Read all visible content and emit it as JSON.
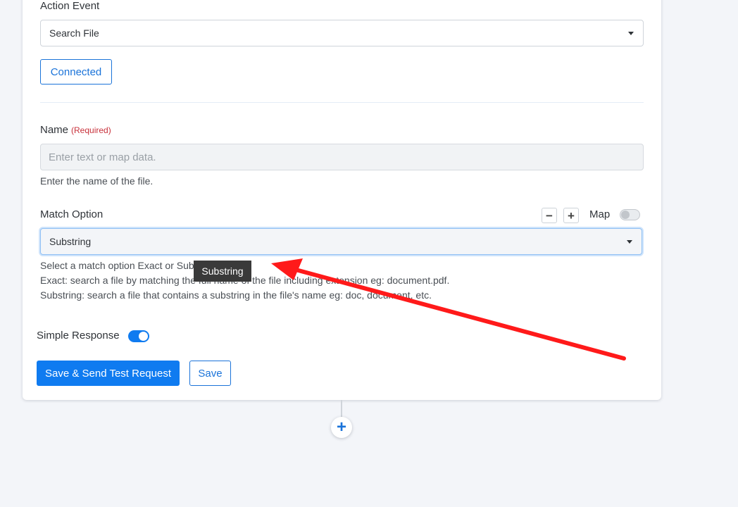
{
  "action_event": {
    "label": "Action Event",
    "selected": "Search File",
    "connected_label": "Connected"
  },
  "name_field": {
    "label": "Name",
    "required_label": "(Required)",
    "placeholder": "Enter text or map data.",
    "value": "",
    "help": "Enter the name of the file."
  },
  "match_option": {
    "label": "Match Option",
    "selected": "Substring",
    "map_label": "Map",
    "map_enabled": false,
    "help_lines": [
      "Select a match option Exact or Substring",
      "Exact: search a file by matching the full name of the file including extension eg: document.pdf.",
      "Substring: search a file that contains a substring in the file's name eg: doc, document, etc."
    ],
    "tooltip": "Substring"
  },
  "simple_response": {
    "label": "Simple Response",
    "enabled": true
  },
  "buttons": {
    "save_send": "Save & Send Test Request",
    "save": "Save"
  },
  "colors": {
    "accent": "#0f7bf0",
    "required": "#c8313b",
    "annotation_arrow": "#ff1a1a"
  },
  "icons": {
    "minus": "−",
    "plus": "+",
    "add_step": "+"
  }
}
